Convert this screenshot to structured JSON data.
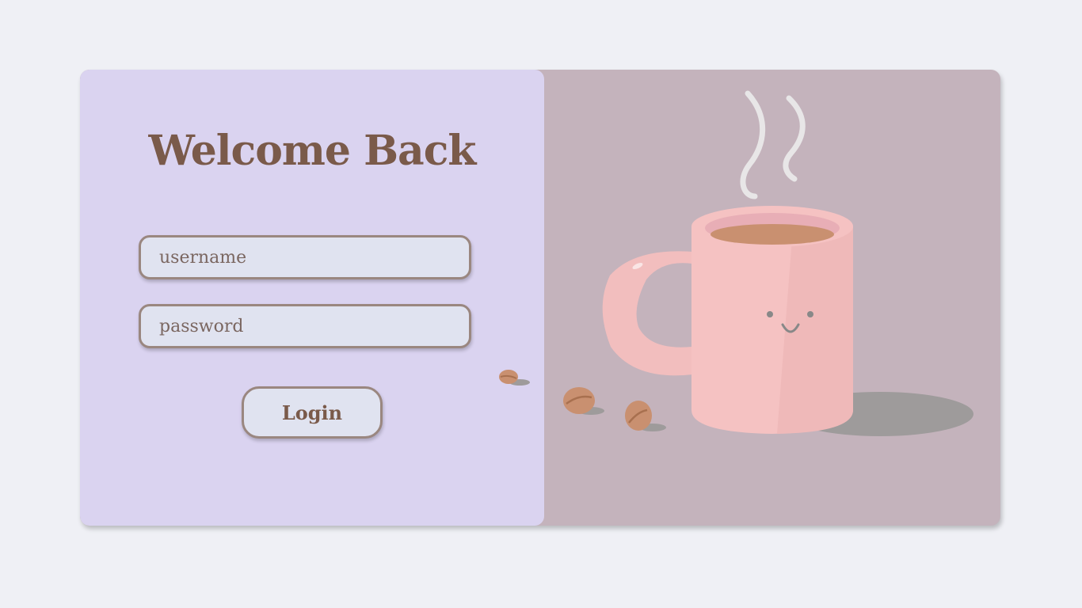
{
  "login": {
    "title": "Welcome Back",
    "username_placeholder": "username",
    "password_placeholder": "password",
    "button_label": "Login"
  },
  "colors": {
    "page_background": "#eff0f5",
    "form_panel": "#dad3f0",
    "illustration_panel": "#c4b3bc",
    "accent_text": "#7a5a4a",
    "field_border": "#9a8780",
    "field_fill": "#e0e3f0",
    "mug": "#f5c2c2"
  },
  "illustration": {
    "subject": "coffee-mug-icon"
  }
}
